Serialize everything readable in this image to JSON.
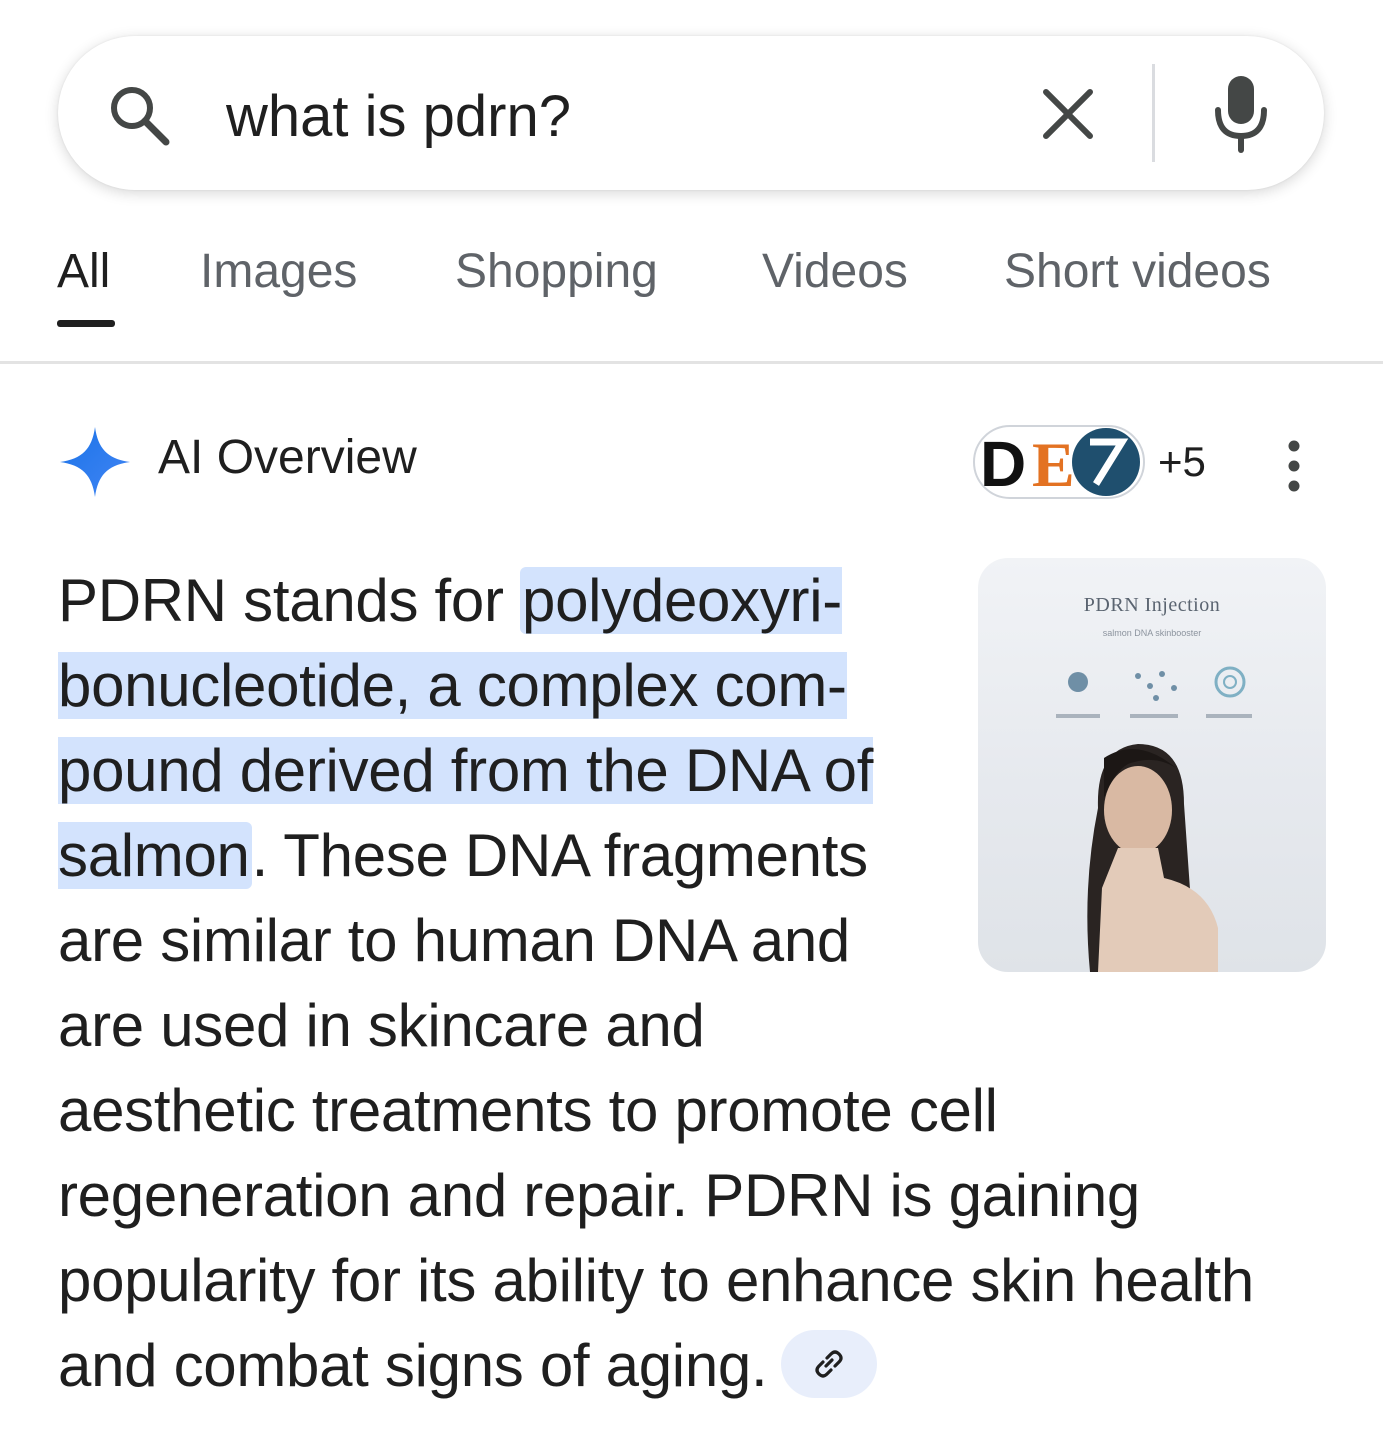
{
  "search": {
    "query": "what is pdrn?"
  },
  "tabs": [
    {
      "label": "All",
      "active": true
    },
    {
      "label": "Images",
      "active": false
    },
    {
      "label": "Shopping",
      "active": false
    },
    {
      "label": "Videos",
      "active": false
    },
    {
      "label": "Short videos",
      "active": false
    }
  ],
  "ai_overview": {
    "title": "AI Overview",
    "source_count": "+5",
    "text": {
      "intro": "PDRN stands for ",
      "highlight": "polydeoxyri­bonucleotide, a complex com­pound derived from the DNA of salmon",
      "rest": ". These DNA frag­ments are similar to human DNA and are used in skincare and aesthetic treatments to promote cell regeneration and repair. PDRN is gaining popularity for its ability to enhance skin health and combat signs of aging."
    },
    "thumbnail": {
      "title": "PDRN Injection",
      "subtitle": "salmon DNA skinbooster"
    },
    "source_logo_text": "DE"
  },
  "colors": {
    "highlight": "#d3e3fd",
    "gemini_blue": "#4285f4",
    "text": "#1f1f1f",
    "muted": "#5f6368"
  },
  "icons": [
    "search-icon",
    "close-icon",
    "mic-icon",
    "sparkle-icon",
    "more-vert-icon",
    "link-icon"
  ]
}
